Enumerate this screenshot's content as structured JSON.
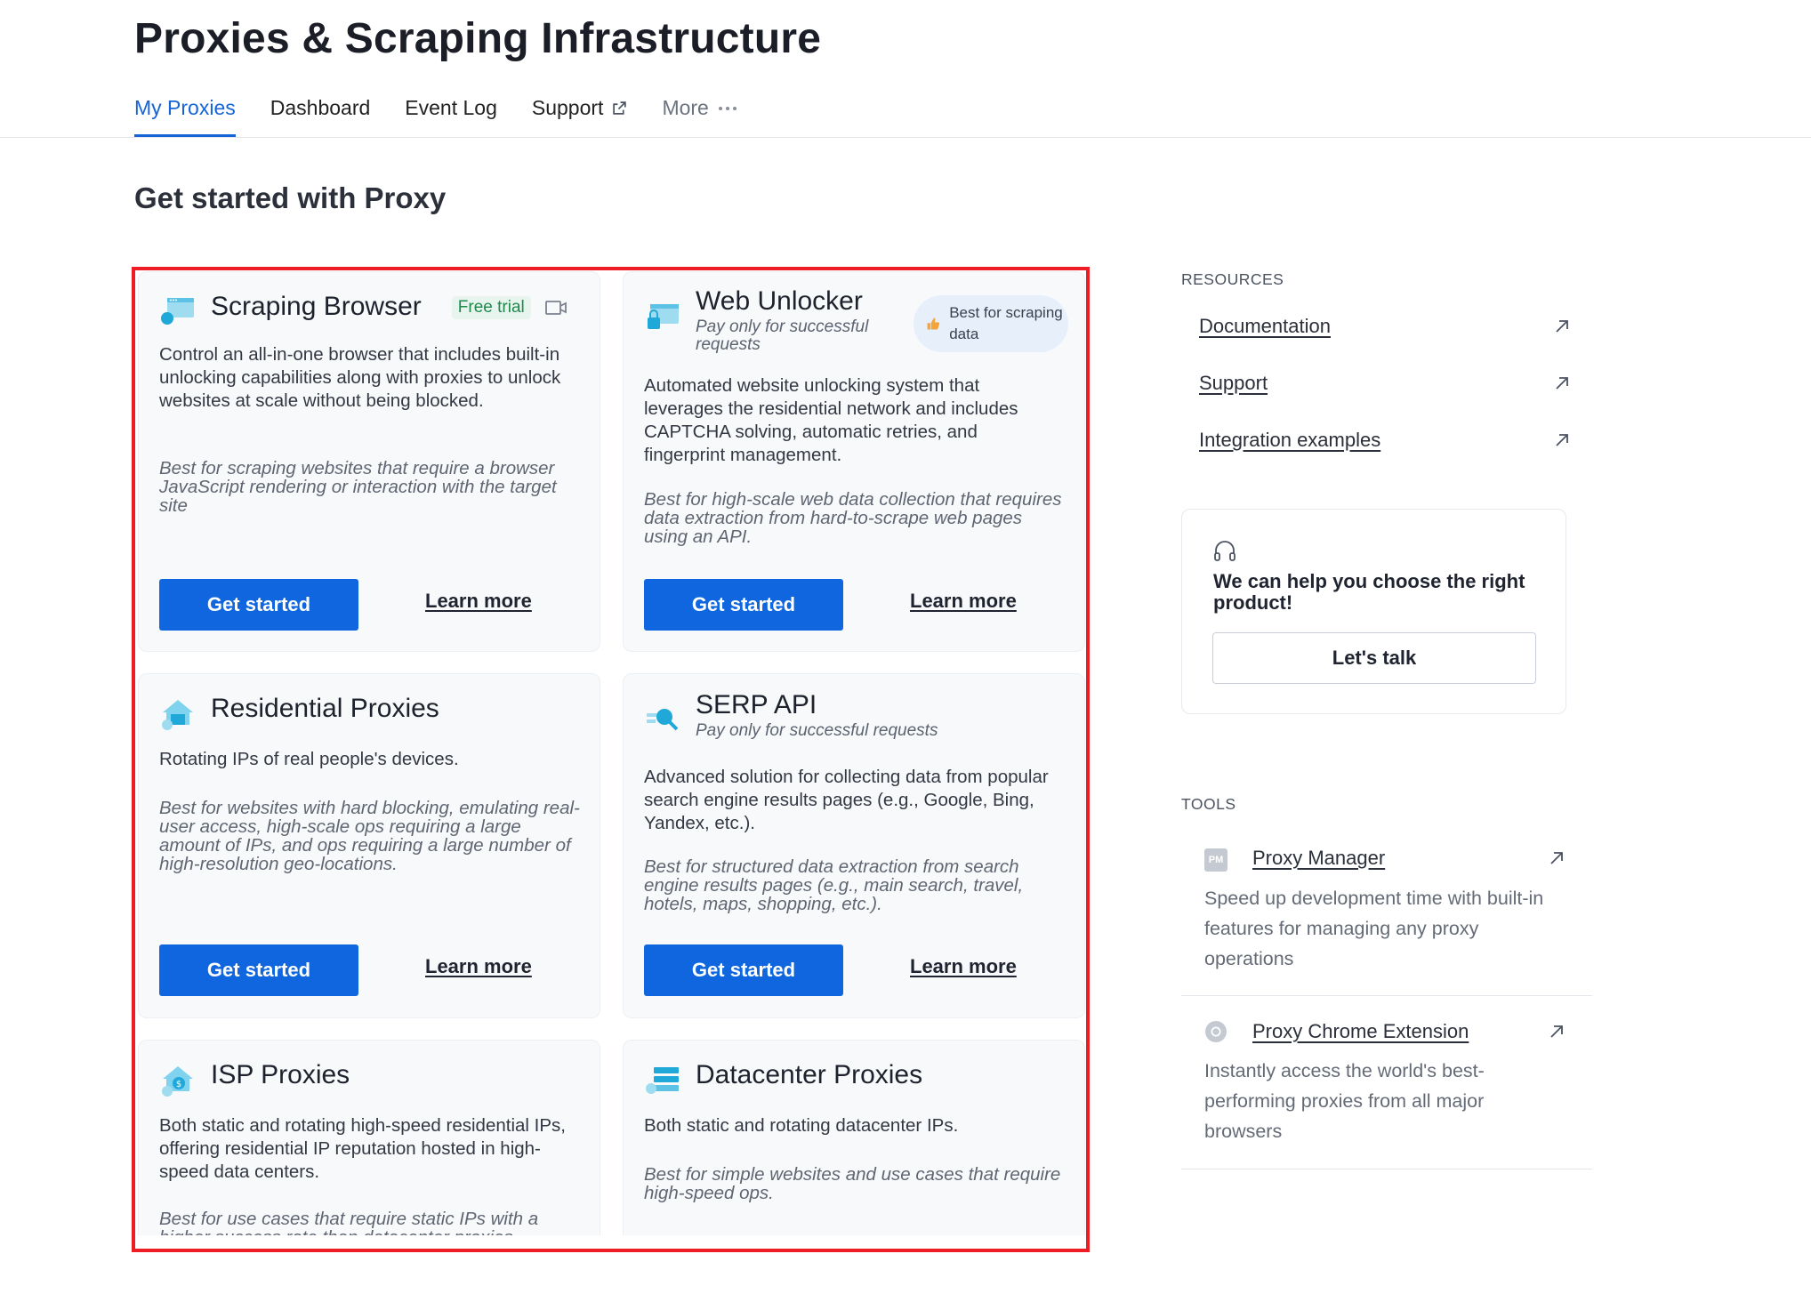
{
  "header": {
    "title": "Proxies & Scraping Infrastructure"
  },
  "tabs": [
    {
      "label": "My Proxies",
      "active": true
    },
    {
      "label": "Dashboard"
    },
    {
      "label": "Event Log"
    },
    {
      "label": "Support",
      "icon": "external-link-icon"
    },
    {
      "label": "More",
      "icon": "more-dots-icon"
    }
  ],
  "main": {
    "section_title": "Get started with Proxy",
    "cards": [
      {
        "title": "Scraping Browser",
        "badge": "Free trial",
        "description": "Control an all-in-one browser that includes built-in unlocking capabilities along with proxies to unlock websites at scale without being blocked.",
        "best_for": "Best for scraping websites that require a browser JavaScript rendering or interaction with the target site",
        "primary_label": "Get started",
        "secondary_label": "Learn more"
      },
      {
        "title": "Web Unlocker",
        "subtitle": "Pay only for successful requests",
        "badge": "Best for scraping data",
        "description": "Automated website unlocking system that leverages the residential network and includes CAPTCHA solving, automatic retries, and fingerprint management.",
        "best_for": "Best for high-scale web data collection that requires data extraction from hard-to-scrape web pages using an API.",
        "primary_label": "Get started",
        "secondary_label": "Learn more"
      },
      {
        "title": "Residential Proxies",
        "description": "Rotating IPs of real people's devices.",
        "best_for": "Best for websites with hard blocking, emulating real-user access, high-scale ops requiring a large amount of IPs, and ops requiring a large number of high-resolution geo-locations.",
        "primary_label": "Get started",
        "secondary_label": "Learn more"
      },
      {
        "title": "SERP API",
        "subtitle": "Pay only for successful requests",
        "description": "Advanced solution for collecting data from popular search engine results pages (e.g., Google, Bing, Yandex, etc.).",
        "best_for": "Best for structured data extraction from search engine results pages (e.g., main search, travel, hotels, maps, shopping, etc.).",
        "primary_label": "Get started",
        "secondary_label": "Learn more"
      },
      {
        "title": "ISP Proxies",
        "description": "Both static and rotating high-speed residential IPs, offering residential IP reputation hosted in high-speed data centers.",
        "best_for": "Best for use cases that require static IPs with a higher success rate than datacenter proxies."
      },
      {
        "title": "Datacenter Proxies",
        "description": "Both static and rotating datacenter IPs.",
        "best_for": "Best for simple websites and use cases that require high-speed ops."
      }
    ]
  },
  "sidebar": {
    "resources_label": "RESOURCES",
    "resources": [
      {
        "label": "Documentation"
      },
      {
        "label": "Support"
      },
      {
        "label": "Integration examples"
      }
    ],
    "help": {
      "title": "We can help you choose the right product!",
      "button_label": "Let's talk"
    },
    "tools_label": "TOOLS",
    "tools": [
      {
        "label": "Proxy Manager",
        "icon_text": "PM",
        "description": "Speed up development time with built-in features for managing any proxy operations"
      },
      {
        "label": "Proxy Chrome Extension",
        "description": "Instantly access the world's best-performing proxies from all major browsers"
      }
    ]
  },
  "colors": {
    "accent": "#0f66de",
    "highlight_border": "#ee1c25",
    "trial_badge": "#1e8a4c",
    "icon": "#2fb0d8"
  }
}
